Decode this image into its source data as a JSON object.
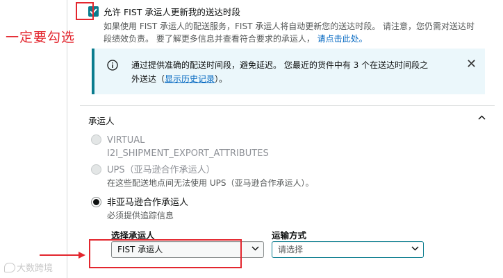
{
  "annotation": {
    "note": "一定要勾选",
    "watermark": "大数跨境"
  },
  "settings": {
    "allow_update_checkbox": {
      "checked": true,
      "label": "允许 FIST 承运人更新我的送达时段"
    },
    "description": {
      "text": "如果使用 FIST 承运人的配送服务，FIST 承运人将自动更新您的送达时段。 请注意，您仍需对送达时段绩效负责。 要了解更多信息并查看符合要求的承运人，",
      "link": "请点击此处。"
    },
    "info_box": {
      "text_before": "通过提供准确的配送时间段，避免延迟。 您最近的货件中有 3 个在送达时间段之外送达（",
      "link": "显示历史记录",
      "text_after": "）。"
    }
  },
  "carrier": {
    "heading": "承运人",
    "options": [
      {
        "title": "VIRTUAL",
        "subtitle": "I2I_SHIPMENT_EXPORT_ATTRIBUTES",
        "disabled": true,
        "selected": false
      },
      {
        "title": "UPS（亚马逊合作承运人）",
        "subtitle": "在这些配送地点间无法使用 UPS（亚马逊合作承运人）。",
        "disabled": true,
        "selected": false
      },
      {
        "title": "非亚马逊合作承运人",
        "subtitle": "必须提供追踪信息",
        "disabled": false,
        "selected": true
      }
    ],
    "select_carrier": {
      "label": "选择承运人",
      "value": "FIST 承运人"
    },
    "shipping_method": {
      "label": "运输方式",
      "placeholder": "请选择"
    }
  },
  "colors": {
    "accent": "#0a7c8e",
    "annotation_red": "#e3262e",
    "link": "#0066c0",
    "info_bg": "#ebf7fb"
  }
}
